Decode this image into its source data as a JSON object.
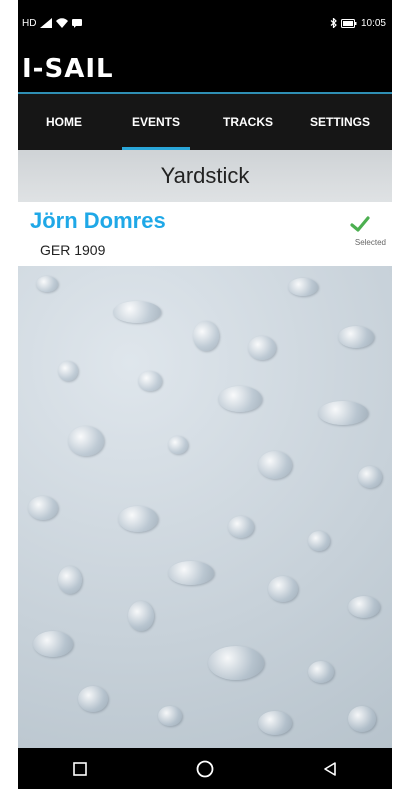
{
  "status": {
    "left_text": "HD",
    "time": "10:05"
  },
  "app": {
    "logo": "I-SAIL"
  },
  "tabs": [
    {
      "label": "HOME"
    },
    {
      "label": "EVENTS"
    },
    {
      "label": "TRACKS"
    },
    {
      "label": "SETTINGS"
    }
  ],
  "active_tab": "EVENTS",
  "page": {
    "title": "Yardstick"
  },
  "entry": {
    "name": "Jörn Domres",
    "sail_number": "GER 1909",
    "status": "Selected"
  },
  "colors": {
    "accent": "#1fa8e7",
    "check": "#4caf50",
    "tab_indicator": "#2aa6d8"
  }
}
